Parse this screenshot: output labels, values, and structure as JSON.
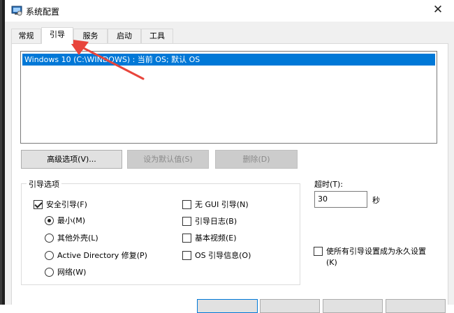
{
  "window": {
    "title": "系统配置",
    "icon": "msconfig-icon",
    "close_glyph": "✕"
  },
  "tabs": [
    {
      "label": "常规",
      "active": false
    },
    {
      "label": "引导",
      "active": true
    },
    {
      "label": "服务",
      "active": false
    },
    {
      "label": "启动",
      "active": false
    },
    {
      "label": "工具",
      "active": false
    }
  ],
  "boot_list": {
    "items": [
      {
        "label": "Windows 10 (C:\\WINDOWS) : 当前 OS; 默认 OS",
        "selected": true
      }
    ]
  },
  "buttons": {
    "advanced": "高级选项(V)...",
    "set_default": "设为默认值(S)",
    "delete": "删除(D)"
  },
  "boot_options": {
    "group_label": "引导选项",
    "safe_boot": {
      "label": "安全引导(F)",
      "checked": true
    },
    "minimal": {
      "label": "最小(M)",
      "checked": true
    },
    "alternate_shell": {
      "label": "其他外壳(L)",
      "checked": false
    },
    "ad_repair": {
      "label": "Active Directory 修复(P)",
      "checked": false
    },
    "network": {
      "label": "网络(W)",
      "checked": false
    },
    "no_gui": {
      "label": "无 GUI 引导(N)",
      "checked": false
    },
    "boot_log": {
      "label": "引导日志(B)",
      "checked": false
    },
    "base_video": {
      "label": "基本视频(E)",
      "checked": false
    },
    "os_boot_info": {
      "label": "OS 引导信息(O)",
      "checked": false
    }
  },
  "timeout": {
    "label": "超时(T):",
    "value": "30",
    "unit": "秒"
  },
  "permanent": {
    "line1": "使所有引导设置成为永久设置",
    "line2": "(K)",
    "checked": false
  },
  "colors": {
    "selection": "#0078d7",
    "annotation_arrow": "#e8453c"
  }
}
